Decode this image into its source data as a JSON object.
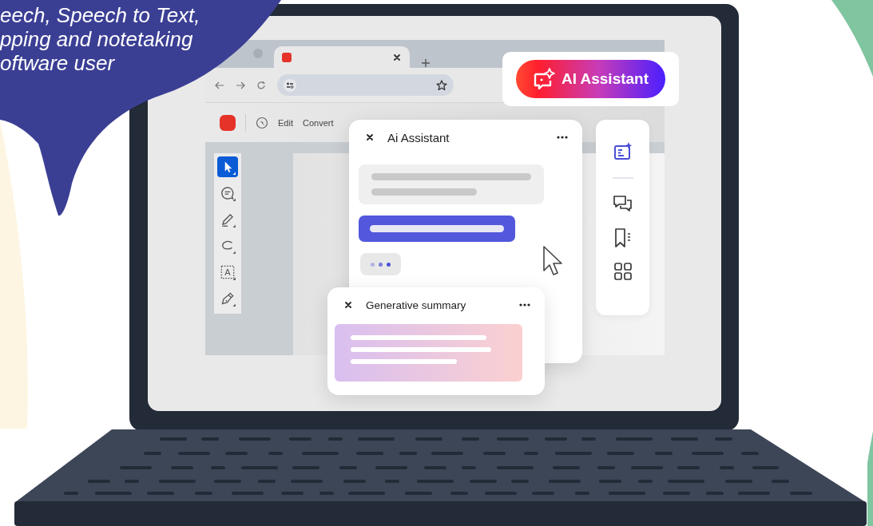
{
  "speech_bubble": {
    "lines": [
      "eech, Speech to Text,",
      "pping and notetaking",
      "oftware user"
    ]
  },
  "browser": {
    "tabs": [
      {
        "selected": false
      },
      {
        "selected": true
      }
    ]
  },
  "toolbar": {
    "items": [
      "Edit",
      "Convert"
    ]
  },
  "tools": [
    {
      "kind": "pointer",
      "selected": true
    },
    {
      "kind": "comment",
      "selected": false
    },
    {
      "kind": "pen",
      "selected": false
    },
    {
      "kind": "lasso",
      "selected": false
    },
    {
      "kind": "text-box",
      "label": "A",
      "selected": false
    },
    {
      "kind": "sign",
      "selected": false
    }
  ],
  "ai_badge": {
    "label": "AI Assistant"
  },
  "assistant_panel": {
    "title": "Ai Assistant"
  },
  "summary_panel": {
    "title": "Generative summary"
  },
  "side_rail": [
    {
      "kind": "ai",
      "selected": true
    },
    {
      "kind": "comments",
      "selected": false
    },
    {
      "kind": "bookmarks",
      "selected": false
    },
    {
      "kind": "grid",
      "selected": false
    }
  ]
}
